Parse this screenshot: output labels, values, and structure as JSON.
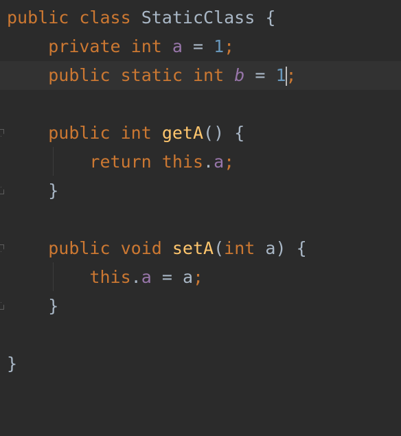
{
  "editor": {
    "language": "Java",
    "lines": {
      "l1": {
        "kw1": "public",
        "kw2": "class",
        "name": "StaticClass",
        "brace": "{"
      },
      "l2": {
        "kw1": "private",
        "kw2": "int",
        "field": "a",
        "op": "=",
        "num": "1",
        "semi": ";"
      },
      "l3": {
        "kw1": "public",
        "kw2": "static",
        "kw3": "int",
        "field": "b",
        "op": "=",
        "num": "1",
        "semi": ";"
      },
      "l5": {
        "kw1": "public",
        "kw2": "int",
        "method": "getA",
        "parens": "()",
        "brace": "{"
      },
      "l6": {
        "kw1": "return",
        "kw2": "this",
        "dot": ".",
        "field": "a",
        "semi": ";"
      },
      "l7": {
        "brace": "}"
      },
      "l9": {
        "kw1": "public",
        "kw2": "void",
        "method": "setA",
        "open": "(",
        "kw3": "int",
        "param": "a",
        "close": ")",
        "brace": "{"
      },
      "l10": {
        "kw1": "this",
        "dot": ".",
        "field": "a",
        "op": "=",
        "param": "a",
        "semi": ";"
      },
      "l11": {
        "brace": "}"
      },
      "l13": {
        "brace": "}"
      }
    },
    "colors": {
      "background": "#2b2b2b",
      "current_line": "#323232",
      "keyword": "#cc7832",
      "field": "#9876aa",
      "number": "#6897bb",
      "method": "#ffc66d",
      "text": "#a9b7c6"
    }
  }
}
